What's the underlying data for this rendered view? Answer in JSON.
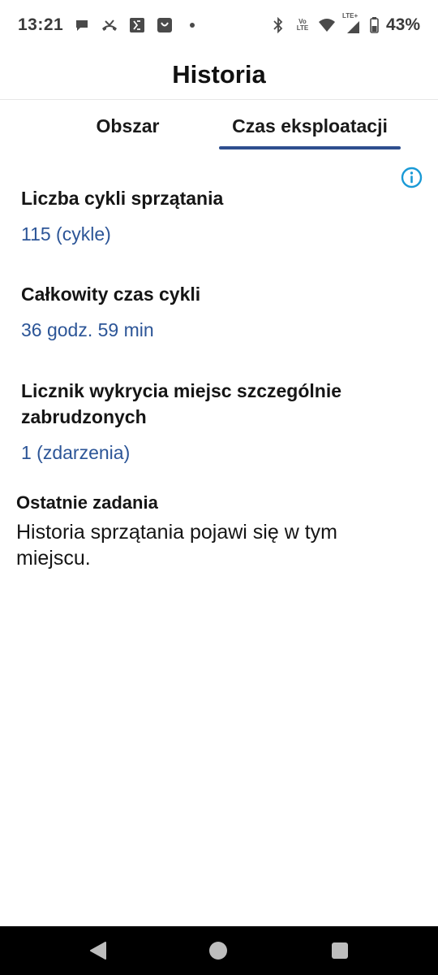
{
  "status_bar": {
    "time": "13:21",
    "battery": "43%",
    "volte_top": "Vo",
    "volte_bottom": "LTE",
    "lte_label": "LTE+",
    "icons": [
      "chat-bubble-icon",
      "missed-call-icon",
      "sim-app-icon",
      "shopping-bag-icon",
      "dot-icon",
      "bluetooth-icon",
      "volte-icon",
      "wifi-icon",
      "signal-icon",
      "battery-icon"
    ]
  },
  "header": {
    "title": "Historia"
  },
  "tabs": [
    {
      "label": "Obszar",
      "active": false
    },
    {
      "label": "Czas eksploatacji",
      "active": true
    }
  ],
  "stats": {
    "cycles": {
      "label": "Liczba cykli sprzątania",
      "value": "115 (cykle)"
    },
    "total_time": {
      "label": "Całkowity czas cykli",
      "value": "36 godz. 59 min"
    },
    "dirt_detect": {
      "label": "Licznik wykrycia miejsc szczególnie zabrudzonych",
      "value": "1 (zdarzenia)"
    }
  },
  "recent": {
    "title": "Ostatnie zadania",
    "body": "Historia sprzątania pojawi się w tym miejscu."
  },
  "colors": {
    "accent": "#2f4f8f",
    "value_text": "#2c5597",
    "info_icon": "#1a9ad6"
  }
}
